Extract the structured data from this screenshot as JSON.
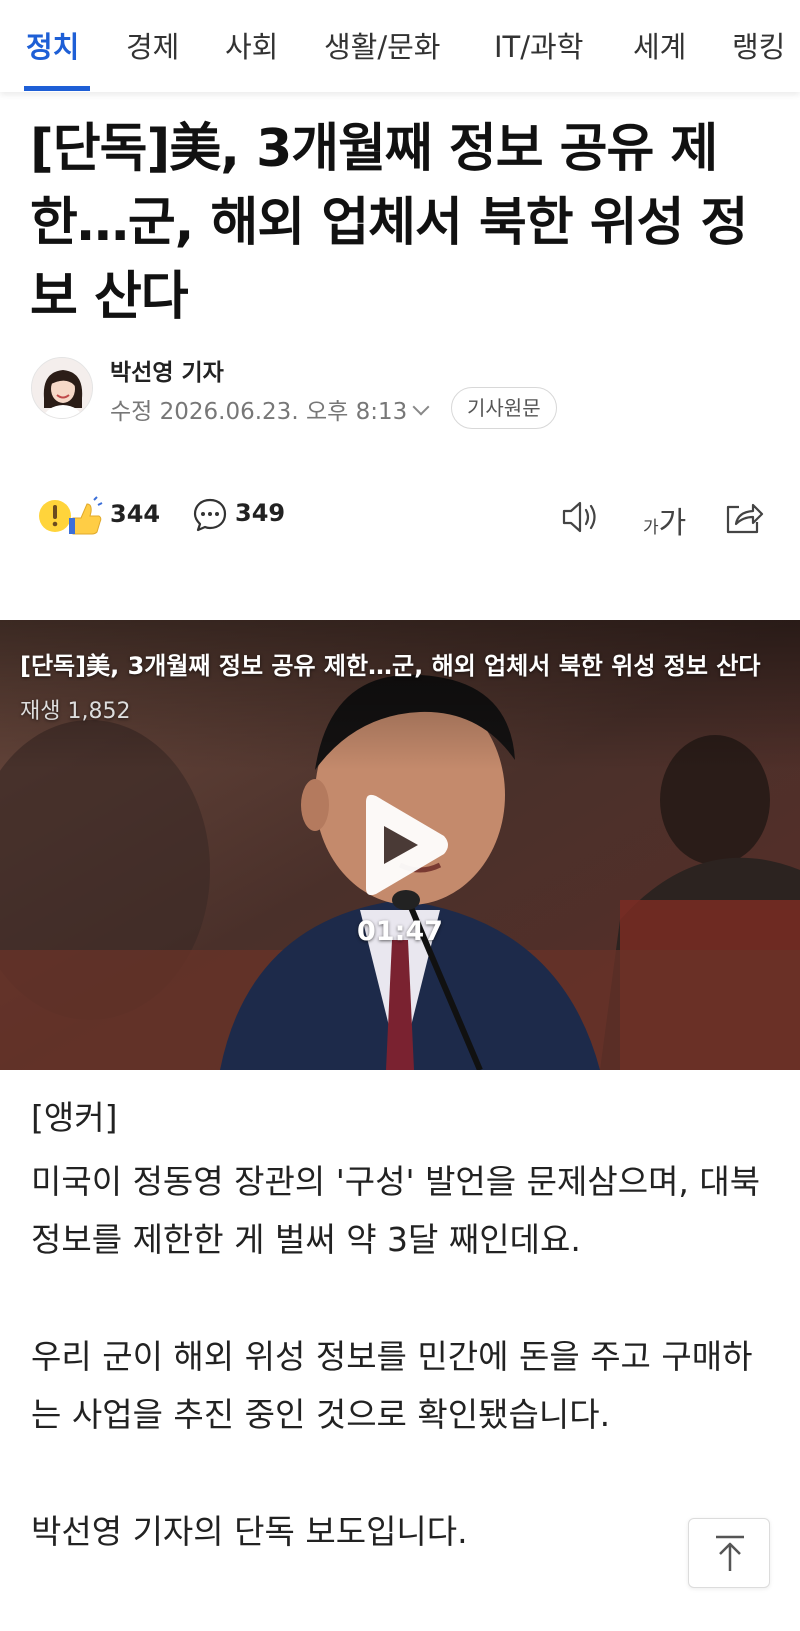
{
  "nav": {
    "tabs": [
      {
        "label": "정치",
        "active": true
      },
      {
        "label": "경제"
      },
      {
        "label": "사회"
      },
      {
        "label": "생활/문화"
      },
      {
        "label": "IT/과학"
      },
      {
        "label": "세계"
      },
      {
        "label": "랭킹"
      }
    ],
    "accent_color": "#1e5fd6"
  },
  "article": {
    "headline": "[단독]美, 3개월째 정보 공유 제한…군, 해외 업체서 북한 위성 정보 산다",
    "reporter": "박선영 기자",
    "dateline": "수정 2026.06.23. 오후 8:13",
    "original_button": "기사원문"
  },
  "actions": {
    "reaction_count": "344",
    "comment_count": "349",
    "icons": [
      "reaction-emoji-icon",
      "comment-bubble-icon",
      "speaker-icon",
      "font-size-icon",
      "share-icon"
    ],
    "font_size_small": "가",
    "font_size_large": "가"
  },
  "video": {
    "title": "[단독]美, 3개월째 정보 공유 제한…군, 해외 업체서 북한 위성 정보 산다",
    "views": "재생 1,852",
    "duration": "01:47"
  },
  "body": {
    "anchor_label": "[앵커]",
    "paragraph1": "미국이 정동영 장관의 '구성' 발언을 문제삼으며, 대북 정보를 제한한 게 벌써 약 3달 째인데요.",
    "paragraph2": "우리 군이 해외 위성 정보를 민간에 돈을 주고 구매하는 사업을 추진 중인 것으로 확인됐습니다.",
    "paragraph3": "박선영 기자의 단독 보도입니다."
  }
}
